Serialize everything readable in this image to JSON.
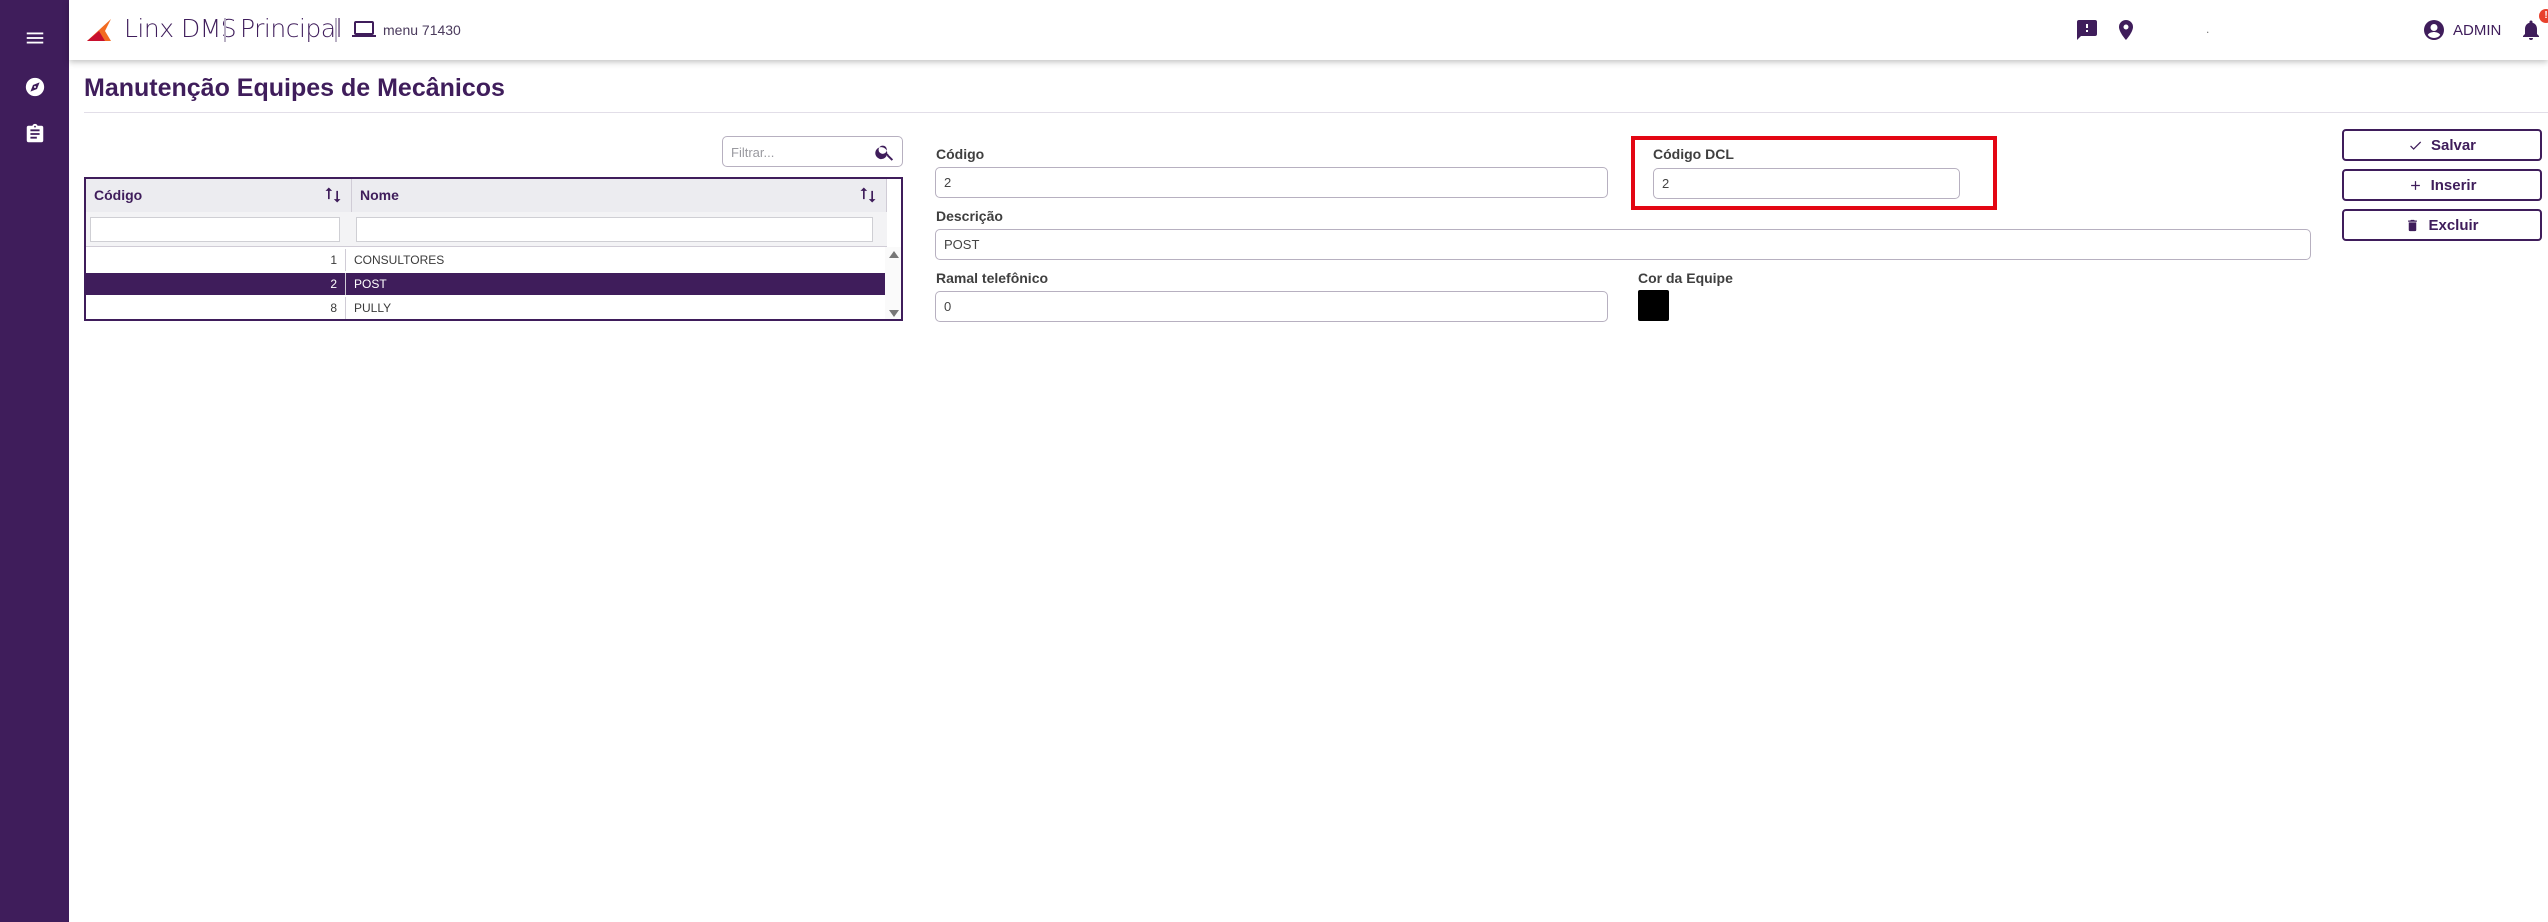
{
  "header": {
    "brand": "Linx DMS",
    "module": "Principal",
    "menu_label": "menu 71430",
    "location_text": ".",
    "user_name": "ADMIN",
    "notification_badge": "!"
  },
  "sidebar": {
    "icons": [
      "hamburger-menu-icon",
      "compass-icon",
      "clipboard-icon"
    ]
  },
  "page": {
    "title": "Manutenção Equipes de Mecânicos"
  },
  "grid": {
    "filter_placeholder": "Filtrar...",
    "columns": [
      "Código",
      "Nome"
    ],
    "rows": [
      {
        "codigo": "1",
        "nome": "CONSULTORES",
        "selected": false
      },
      {
        "codigo": "2",
        "nome": "POST",
        "selected": true
      },
      {
        "codigo": "8",
        "nome": "PULLY",
        "selected": false
      }
    ]
  },
  "form": {
    "codigo_label": "Código",
    "codigo_value": "2",
    "codigo_dcl_label": "Código DCL",
    "codigo_dcl_value": "2",
    "descricao_label": "Descrição",
    "descricao_value": "POST",
    "ramal_label": "Ramal telefônico",
    "ramal_value": "0",
    "cor_label": "Cor da Equipe",
    "cor_value": "#000000"
  },
  "actions": {
    "save_label": "Salvar",
    "insert_label": "Inserir",
    "delete_label": "Excluir"
  },
  "colors": {
    "brand_purple": "#3f1d5b",
    "highlight_red": "#e30613",
    "logo_orange": "#f26b21"
  }
}
